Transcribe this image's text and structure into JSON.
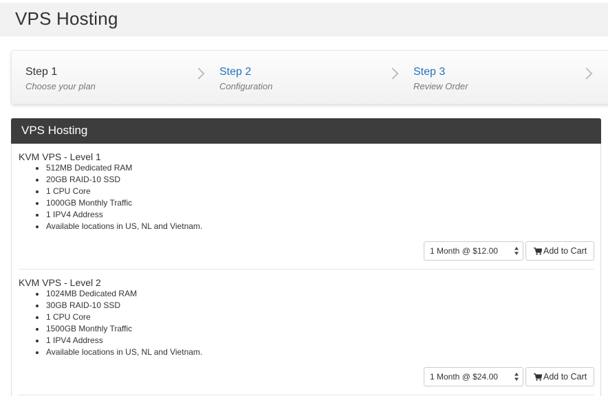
{
  "header": {
    "title": "VPS Hosting"
  },
  "steps": [
    {
      "name": "Step 1",
      "sub": "Choose your plan",
      "active": false
    },
    {
      "name": "Step 2",
      "sub": "Configuration",
      "active": true
    },
    {
      "name": "Step 3",
      "sub": "Review Order",
      "active": true
    }
  ],
  "panel": {
    "title": "VPS Hosting"
  },
  "products": [
    {
      "name": "KVM VPS - Level 1",
      "features": [
        "512MB Dedicated RAM",
        "20GB RAID-10 SSD",
        "1 CPU Core",
        "1000GB Monthly Traffic",
        "1 IPV4 Address",
        "Available locations in US, NL and Vietnam."
      ],
      "billing_cycle": "1 Month @ $12.00",
      "add_label": "Add to Cart"
    },
    {
      "name": "KVM VPS - Level 2",
      "features": [
        "1024MB Dedicated RAM",
        "30GB RAID-10 SSD",
        "1 CPU Core",
        "1500GB Monthly Traffic",
        "1 IPV4 Address",
        "Available locations in US, NL and Vietnam."
      ],
      "billing_cycle": "1 Month @ $24.00",
      "add_label": "Add to Cart"
    }
  ],
  "icons": {
    "step_separator": "chevron-right-icon",
    "select_arrows": "updown-arrows-icon",
    "cart": "shopping-cart-icon"
  },
  "colors": {
    "active_step": "#1e73be",
    "panel_heading": "#3d3d3d"
  }
}
